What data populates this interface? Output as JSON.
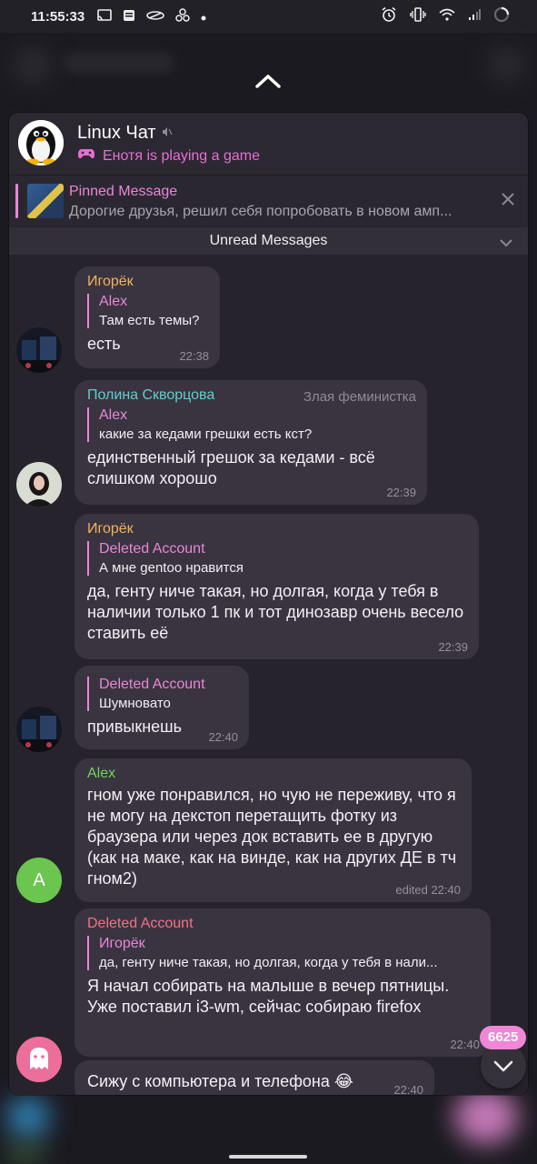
{
  "status_bar": {
    "time": "11:55:33",
    "icons_left": [
      "cast-icon",
      "news-icon",
      "swoosh-icon",
      "fan-icon",
      "dot-icon"
    ],
    "icons_right": [
      "alarm-icon",
      "vibrate-icon",
      "wifi-icon",
      "signal-icon",
      "loading-icon"
    ]
  },
  "chat": {
    "title": "Linux Чат",
    "status": "Енотя is playing a game"
  },
  "pinned": {
    "label": "Pinned Message",
    "text": "Дорогие друзья, решил себя попробовать в новом амп..."
  },
  "unread_label": "Unread Messages",
  "messages": [
    {
      "sender": "Игорёк",
      "reply_name": "Alex",
      "reply_text": "Там есть темы?",
      "text": "есть",
      "time": "22:38"
    },
    {
      "sender": "Полина Скворцова",
      "title": "Злая феминистка",
      "reply_name": "Alex",
      "reply_text": "какие за кедами грешки есть кст?",
      "text": "единственный грешок за кедами - всё слишком хорошо",
      "time": "22:39"
    },
    {
      "sender": "Игорёк",
      "reply_name": "Deleted Account",
      "reply_text": "А мне gentoo нравится",
      "text": "да, генту ниче такая, но долгая, когда у тебя в наличии только 1 пк и тот динозавр очень весело ставить её",
      "time": "22:39"
    },
    {
      "reply_name": "Deleted Account",
      "reply_text": "Шумновато",
      "text": "привыкнешь",
      "time": "22:40"
    },
    {
      "sender": "Alex",
      "text": "гном уже понравился, но чую не переживу, что я не могу на декстоп перетащить фотку из браузера или через док вставить ее в другую (как на маке, как на винде, как на других ДЕ в тч гном2)",
      "time": "edited 22:40"
    },
    {
      "sender": "Deleted Account",
      "reply_name": "Игорёк",
      "reply_text": "да, генту ниче такая, но долгая, когда у тебя в нали...",
      "text": "Я начал собирать на малыше в вечер пятницы. Уже поставил i3-wm, сейчас собираю firefox",
      "time": "22:40"
    },
    {
      "text": "Сижу с компьютера и телефона 😂",
      "time": "22:40"
    }
  ],
  "avatar_alex_letter": "A",
  "scroll_badge": "6625",
  "colors": {
    "accent": "#e887d6",
    "sender_igorek": "#f0b35b",
    "sender_polina": "#5fd0cf",
    "sender_alex": "#6ed45b",
    "sender_deleted": "#f07387",
    "bubble": "#3a3440"
  }
}
